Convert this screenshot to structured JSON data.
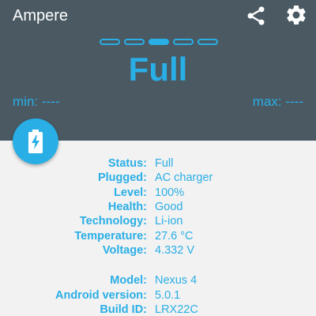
{
  "app": {
    "title": "Ampere"
  },
  "colors": {
    "header_bg": "#4a5962",
    "accent": "#29aee6",
    "body_bg": "#f2f2f2"
  },
  "toolbar": {
    "share_icon": "share-icon",
    "settings_icon": "gear-icon"
  },
  "pager": {
    "count": 5,
    "active_index": 2
  },
  "status": {
    "big_text": "Full",
    "min": "min: ----",
    "max": "max: ----"
  },
  "fab_icon": "battery-charging-icon",
  "battery_info": [
    {
      "label": "Status:",
      "value": "Full"
    },
    {
      "label": "Plugged:",
      "value": "AC charger"
    },
    {
      "label": "Level:",
      "value": "100%"
    },
    {
      "label": "Health:",
      "value": "Good"
    },
    {
      "label": "Technology:",
      "value": "Li-ion"
    },
    {
      "label": "Temperature:",
      "value": "27.6 °C"
    },
    {
      "label": "Voltage:",
      "value": "4.332 V"
    }
  ],
  "device_info": [
    {
      "label": "Model:",
      "value": "Nexus 4"
    },
    {
      "label": "Android version:",
      "value": "5.0.1"
    },
    {
      "label": "Build ID:",
      "value": "LRX22C"
    }
  ]
}
